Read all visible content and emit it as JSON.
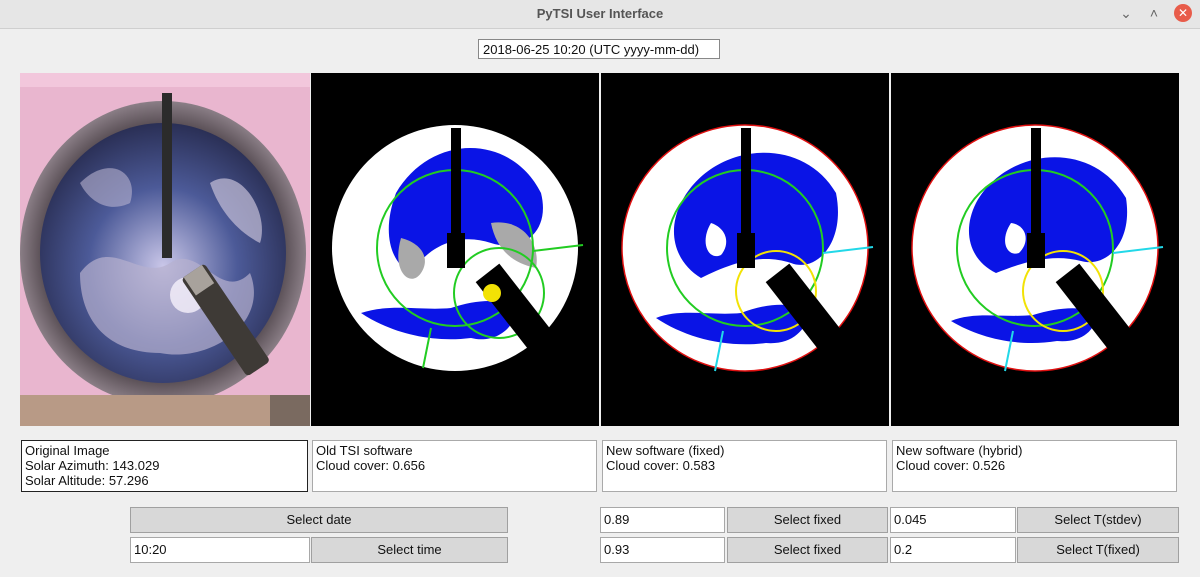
{
  "window": {
    "title": "PyTSI User Interface"
  },
  "date_field": {
    "value": "2018-06-25 10:20 (UTC yyyy-mm-dd)"
  },
  "panels": [
    {
      "lines": [
        "Original Image",
        "Solar Azimuth: 143.029",
        "Solar Altitude: 57.296"
      ]
    },
    {
      "lines": [
        "Old TSI software",
        "Cloud cover: 0.656"
      ]
    },
    {
      "lines": [
        "New software (fixed)",
        "Cloud cover: 0.583"
      ]
    },
    {
      "lines": [
        "New software (hybrid)",
        "Cloud cover: 0.526"
      ]
    }
  ],
  "controls": {
    "select_date_label": "Select date",
    "time_value": "10:20",
    "select_time_label": "Select time",
    "fixed_value_1": "0.89",
    "select_fixed_label_1": "Select fixed",
    "fixed_value_2": "0.93",
    "select_fixed_label_2": "Select fixed",
    "tstdev_value": "0.045",
    "select_tstdev_label": "Select T(stdev)",
    "tfixed_value": "0.2",
    "select_tfixed_label": "Select T(fixed)"
  },
  "colors": {
    "cloud_free": "#0a14e6",
    "cloud": "#ffffff",
    "thin_cloud": "#a9a9a9",
    "horizon_ring": "#22cc22",
    "sun_circle": "#f2e205",
    "sector_line": "#22d8e8",
    "edge": "#e01010"
  }
}
